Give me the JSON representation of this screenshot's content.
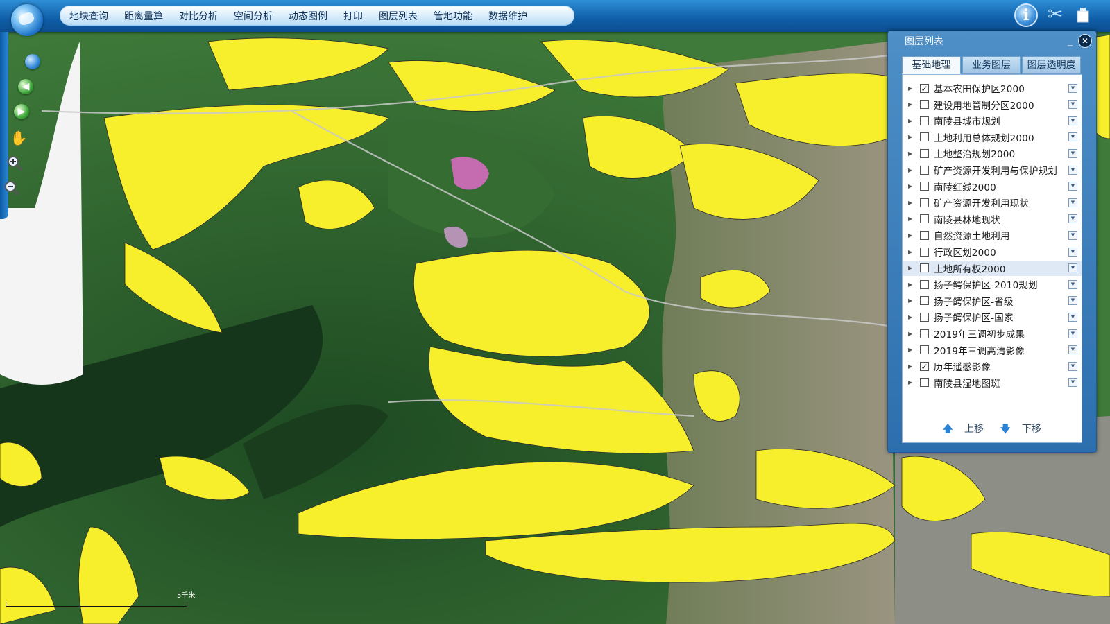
{
  "menu": {
    "items": [
      "地块查询",
      "距离量算",
      "对比分析",
      "空间分析",
      "动态图例",
      "打印",
      "图层列表",
      "管地功能",
      "数据维护"
    ]
  },
  "toolbar_right": {
    "info_icon": "info-icon",
    "scissors_icon": "scissors-icon",
    "clear_icon": "eraser-icon",
    "info_glyph": "i",
    "scissors_glyph": "✂"
  },
  "left_tools": [
    "globe-icon",
    "back-arrow-icon",
    "forward-arrow-icon",
    "pan-hand-icon",
    "zoom-in-icon",
    "zoom-out-icon"
  ],
  "layer_panel": {
    "title": "图层列表",
    "minimize": "_",
    "close": "✕",
    "tabs": [
      "基础地理",
      "业务图层",
      "图层透明度"
    ],
    "active_tab": 0,
    "layers": [
      {
        "name": "基本农田保护区2000",
        "checked": true
      },
      {
        "name": "建设用地管制分区2000",
        "checked": false
      },
      {
        "name": "南陵县城市规划",
        "checked": false
      },
      {
        "name": "土地利用总体规划2000",
        "checked": false
      },
      {
        "name": "土地整治规划2000",
        "checked": false
      },
      {
        "name": "矿产资源开发利用与保护规划",
        "checked": false
      },
      {
        "name": "南陵红线2000",
        "checked": false
      },
      {
        "name": "矿产资源开发利用现状",
        "checked": false
      },
      {
        "name": "南陵县林地现状",
        "checked": false
      },
      {
        "name": "自然资源土地利用",
        "checked": false
      },
      {
        "name": "行政区划2000",
        "checked": false
      },
      {
        "name": "土地所有权2000",
        "checked": false,
        "selected": true
      },
      {
        "name": "扬子鳄保护区-2010规划",
        "checked": false
      },
      {
        "name": "扬子鳄保护区-省级",
        "checked": false
      },
      {
        "name": "扬子鳄保护区-国家",
        "checked": false
      },
      {
        "name": "2019年三调初步成果",
        "checked": false
      },
      {
        "name": "2019年三调高清影像",
        "checked": false
      },
      {
        "name": "历年遥感影像",
        "checked": true
      },
      {
        "name": "南陵县湿地图斑",
        "checked": false
      }
    ],
    "move_up": "上移",
    "move_down": "下移",
    "up_arrow": "🡅",
    "down_arrow": "🡇"
  },
  "map": {
    "scale_label": "5千米",
    "overlay_color": "#f7ef2c",
    "forest_color": "#2f6b2e"
  }
}
